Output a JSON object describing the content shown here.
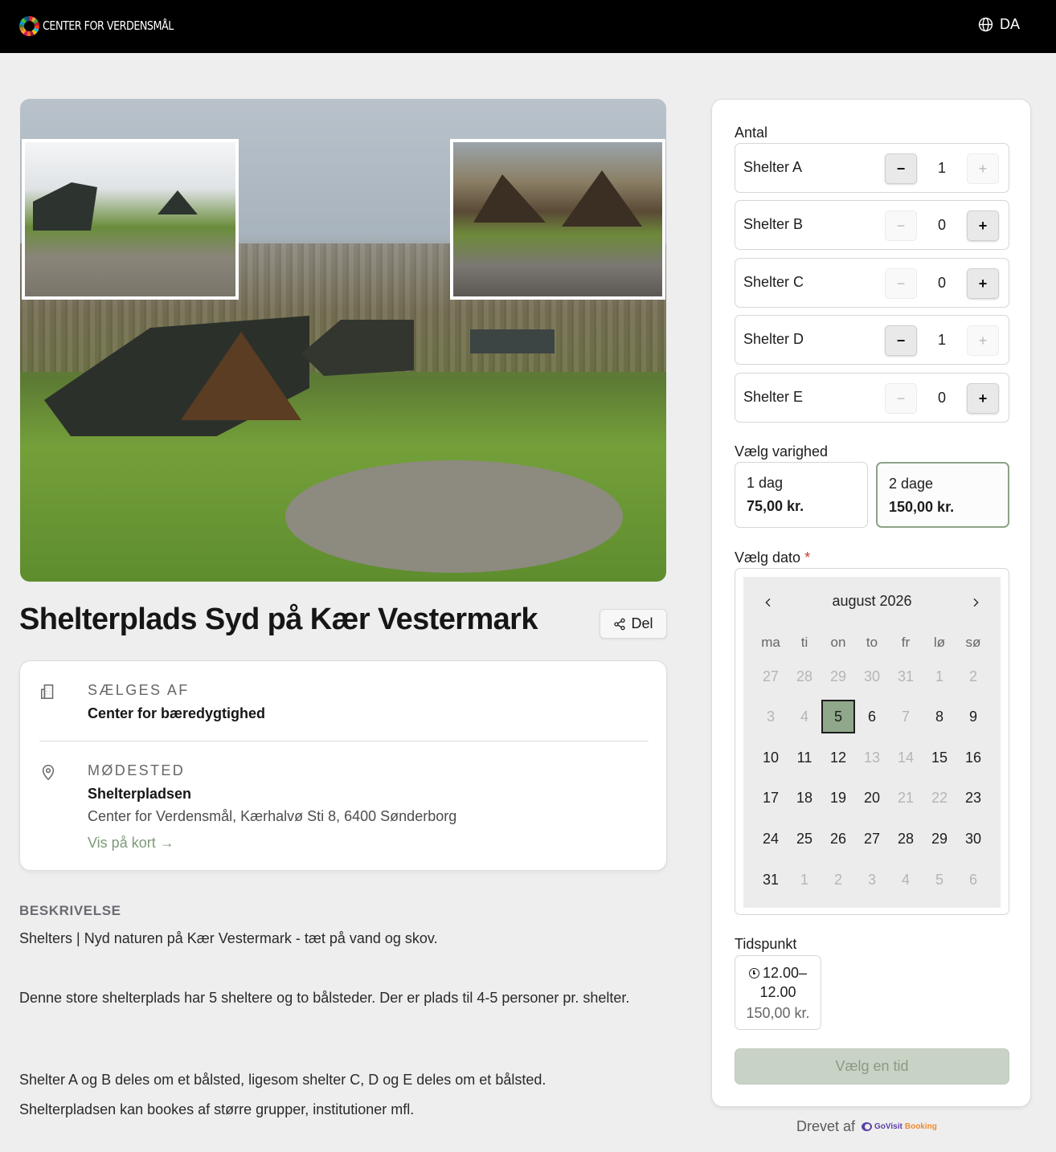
{
  "header": {
    "logo_text": "CENTER FOR VERDENSMÅL",
    "language": "DA"
  },
  "hero": {
    "alt": "Shelterplads photo"
  },
  "product": {
    "title": "Shelterplads Syd på Kær Vestermark",
    "share_label": "Del"
  },
  "info": {
    "seller_label": "SÆLGES AF",
    "seller_name": "Center for bæredygtighed",
    "meeting_label": "MØDESTED",
    "meeting_name": "Shelterpladsen",
    "meeting_address": "Center for Verdensmål, Kærhalvø Sti 8, 6400 Sønderborg",
    "map_link": "Vis på kort →"
  },
  "description": {
    "heading": "BESKRIVELSE",
    "paragraphs": [
      "Shelters | Nyd naturen på Kær Vestermark - tæt på vand og skov.",
      "Denne store shelterplads har 5 sheltere og to bålsteder. Der er plads til 4-5 personer pr. shelter.",
      "Shelter A og B deles om et bålsted, ligesom shelter C, D og E deles om et bålsted.",
      "Shelterpladsen kan bookes af større grupper, institutioner mfl."
    ]
  },
  "booking": {
    "quantity_label": "Antal",
    "items": [
      {
        "name": "Shelter A",
        "qty": "1",
        "minus": "−",
        "plus": "+"
      },
      {
        "name": "Shelter B",
        "qty": "0",
        "minus": "−",
        "plus": "+"
      },
      {
        "name": "Shelter C",
        "qty": "0",
        "minus": "−",
        "plus": "+"
      },
      {
        "name": "Shelter D",
        "qty": "1",
        "minus": "−",
        "plus": "+"
      },
      {
        "name": "Shelter E",
        "qty": "0",
        "minus": "−",
        "plus": "+"
      }
    ],
    "duration_label": "Vælg varighed",
    "durations": [
      {
        "name": "1 dag",
        "price": "75,00 kr."
      },
      {
        "name": "2 dage",
        "price": "150,00 kr."
      }
    ],
    "selected_duration": "2 dage",
    "date_label": "Vælg dato",
    "required_mark": "*",
    "calendar": {
      "month": "august 2026",
      "prev": "‹",
      "next": "›",
      "weekdays": [
        "ma",
        "ti",
        "on",
        "to",
        "fr",
        "lø",
        "sø"
      ],
      "weeks": [
        [
          "27",
          "28",
          "29",
          "30",
          "31",
          "1",
          "2"
        ],
        [
          "3",
          "4",
          "5",
          "6",
          "7",
          "8",
          "9"
        ],
        [
          "10",
          "11",
          "12",
          "13",
          "14",
          "15",
          "16"
        ],
        [
          "17",
          "18",
          "19",
          "20",
          "21",
          "22",
          "23"
        ],
        [
          "24",
          "25",
          "26",
          "27",
          "28",
          "29",
          "30"
        ],
        [
          "31",
          "1",
          "2",
          "3",
          "4",
          "5",
          "6"
        ]
      ],
      "selected_day": "5"
    },
    "time_label": "Tidspunkt",
    "time_slot": {
      "line1": "12.00–",
      "line2": "12.00",
      "price": "150,00 kr."
    },
    "cta_label": "Vælg en tid"
  },
  "footer": {
    "powered_by": "Drevet af",
    "brand_a": "GoVisit",
    "brand_b": "Booking"
  },
  "colors": {
    "accent": "#8fa78a",
    "cta_disabled_bg": "#c8d3c6",
    "header_bg": "#000000",
    "page_bg": "#eeeeee"
  }
}
